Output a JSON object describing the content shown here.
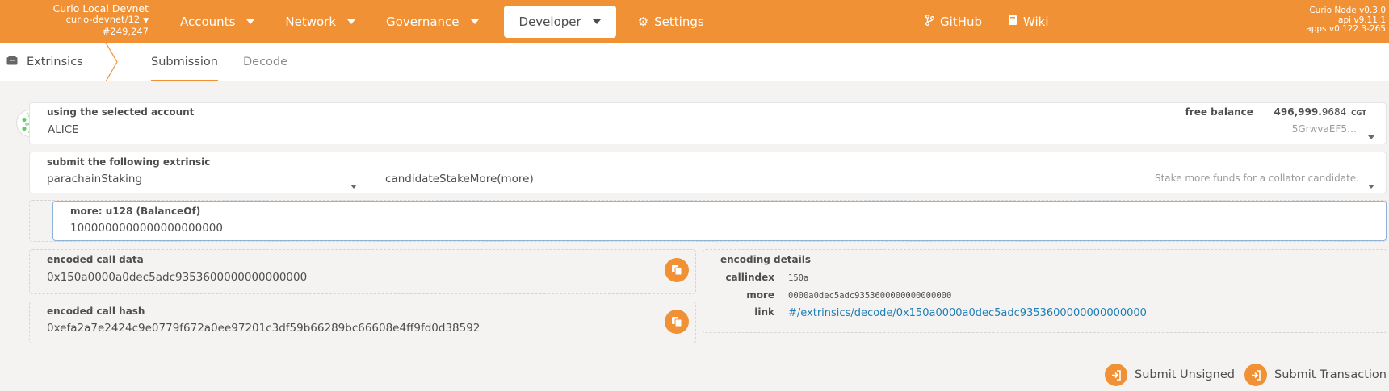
{
  "chain": {
    "name": "Curio Local Devnet",
    "node": "curio-devnet/12",
    "block": "#249,247"
  },
  "menu": {
    "accounts": "Accounts",
    "network": "Network",
    "governance": "Governance",
    "developer": "Developer",
    "settings": "Settings",
    "github": "GitHub",
    "wiki": "Wiki"
  },
  "version": {
    "node": "Curio Node v0.3.0",
    "api": "api v9.11.1",
    "apps": "apps v0.122.3-265"
  },
  "subnav": {
    "section": "Extrinsics",
    "tabs": [
      "Submission",
      "Decode"
    ]
  },
  "account": {
    "label": "using the selected account",
    "name": "ALICE",
    "free_balance_label": "free balance",
    "balance_int": "496,999.",
    "balance_dec": "9684",
    "balance_unit": "CGT",
    "address": "5GrwvaEF5…"
  },
  "extrinsic": {
    "label": "submit the following extrinsic",
    "pallet": "parachainStaking",
    "call": "candidateStakeMore(more)",
    "description": "Stake more funds for a collator candidate."
  },
  "param": {
    "label": "more: u128 (BalanceOf)",
    "value": "1000000000000000000000"
  },
  "encoded_call_data": {
    "label": "encoded call data",
    "value": "0x150a0000a0dec5adc9353600000000000000"
  },
  "encoded_call_hash": {
    "label": "encoded call hash",
    "value": "0xefa2a7e2424c9e0779f672a0ee97201c3df59b66289bc66608e4ff9fd0d38592"
  },
  "encoding_details": {
    "title": "encoding details",
    "callindex_label": "callindex",
    "callindex_value": "150a",
    "more_label": "more",
    "more_value": "0000a0dec5adc9353600000000000000",
    "link_label": "link",
    "link_value": "#/extrinsics/decode/0x150a0000a0dec5adc9353600000000000000"
  },
  "actions": {
    "submit_unsigned": "Submit Unsigned",
    "submit_transaction": "Submit Transaction"
  },
  "colors": {
    "accent": "#f19135",
    "link": "#1f7fb6"
  },
  "icons": [
    "chevron-down-icon",
    "gear-icon",
    "github-icon",
    "book-icon",
    "extrinsics-icon",
    "copy-icon",
    "sign-in-icon",
    "identicon"
  ]
}
